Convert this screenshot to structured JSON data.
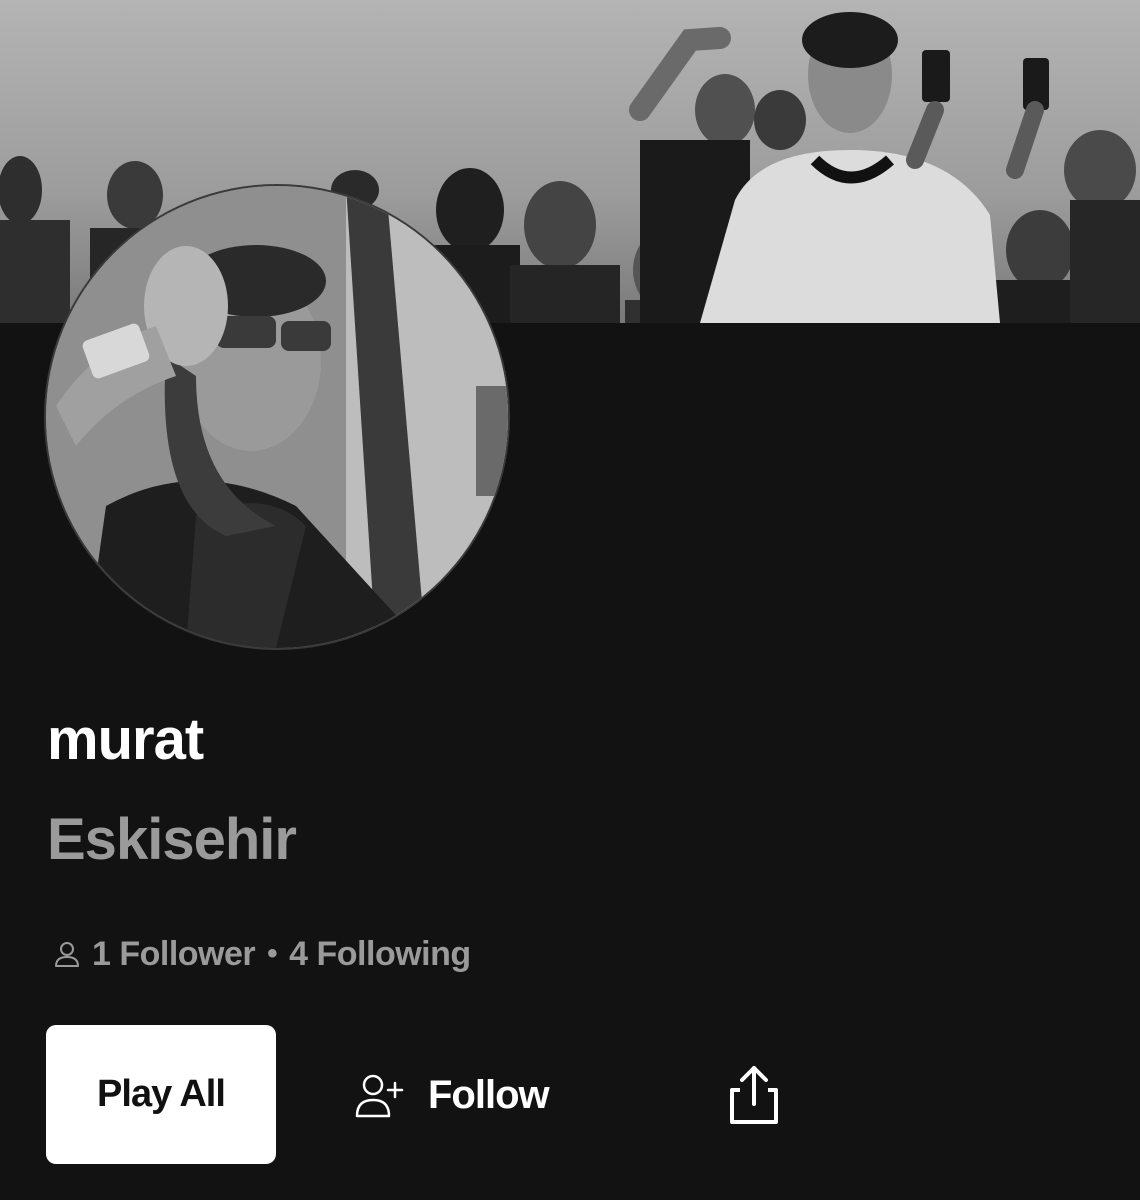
{
  "profile": {
    "username": "murat",
    "location": "Eskisehir",
    "followers_label": "1 Follower",
    "separator": "•",
    "following_label": "4 Following"
  },
  "actions": {
    "play_all_label": "Play All",
    "follow_label": "Follow"
  },
  "icons": {
    "stats": "user-icon",
    "follow": "add-user-icon",
    "share": "share-icon"
  },
  "colors": {
    "background": "#121212",
    "primary_text": "#ffffff",
    "secondary_text": "#9a9a9a",
    "play_button_bg": "#ffffff",
    "play_button_text": "#111111"
  }
}
